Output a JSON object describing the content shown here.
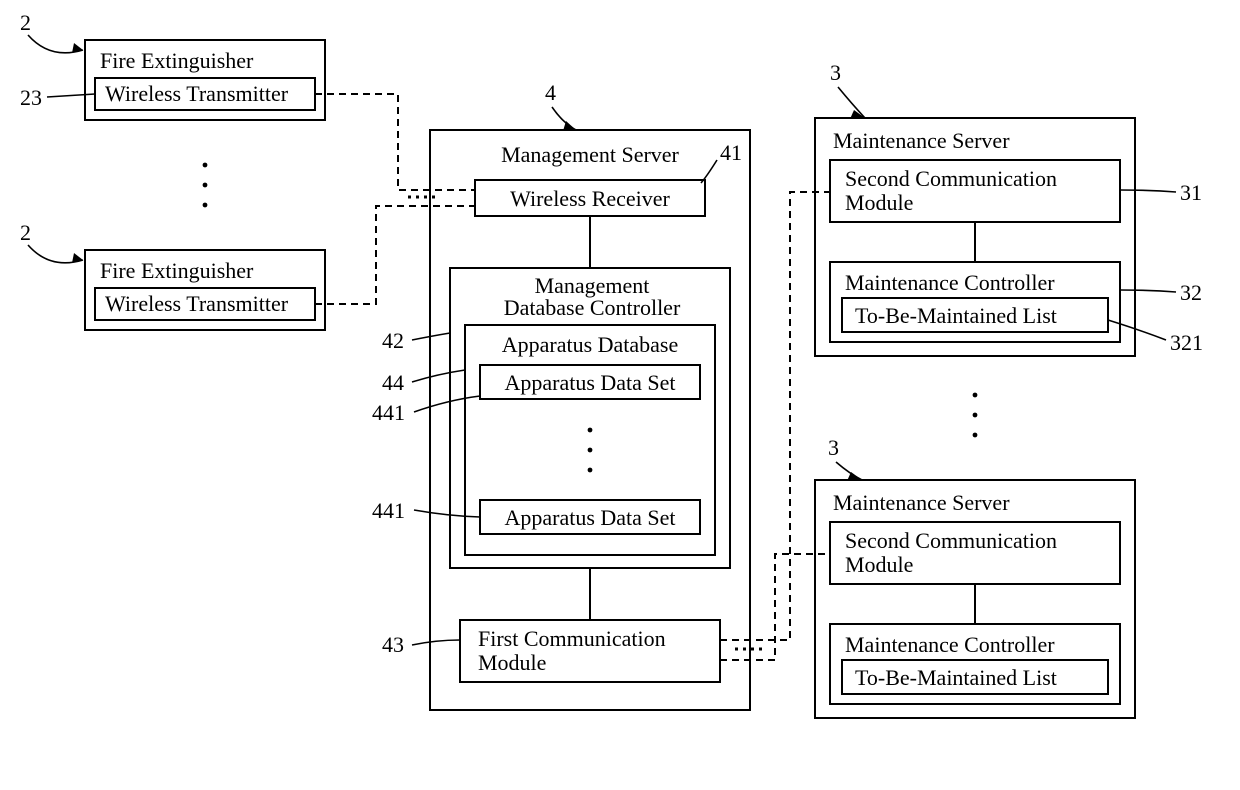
{
  "fire_extinguisher_1": {
    "title": "Fire Extinguisher",
    "transmitter": "Wireless Transmitter"
  },
  "fire_extinguisher_2": {
    "title": "Fire Extinguisher",
    "transmitter": "Wireless Transmitter"
  },
  "management_server": {
    "title": "Management Server",
    "receiver": "Wireless Receiver",
    "db_controller": "Management\nDatabase Controller",
    "apparatus_db": "Apparatus Database",
    "data_set_1": "Apparatus Data Set",
    "data_set_2": "Apparatus Data Set",
    "first_comm": "First Communication\n Module"
  },
  "maintenance_server_1": {
    "title": "Maintenance Server",
    "second_comm": "Second Communication\n Module",
    "controller": "Maintenance Controller",
    "list": "To-Be-Maintained List"
  },
  "maintenance_server_2": {
    "title": "Maintenance Server",
    "second_comm": "Second Communication\n Module",
    "controller": "Maintenance Controller",
    "list": "To-Be-Maintained List"
  },
  "refs": {
    "r2a": "2",
    "r2b": "2",
    "r23": "23",
    "r4": "4",
    "r41": "41",
    "r42": "42",
    "r43": "43",
    "r44": "44",
    "r441a": "441",
    "r441b": "441",
    "r3a": "3",
    "r3b": "3",
    "r31": "31",
    "r32": "32",
    "r321": "321"
  }
}
